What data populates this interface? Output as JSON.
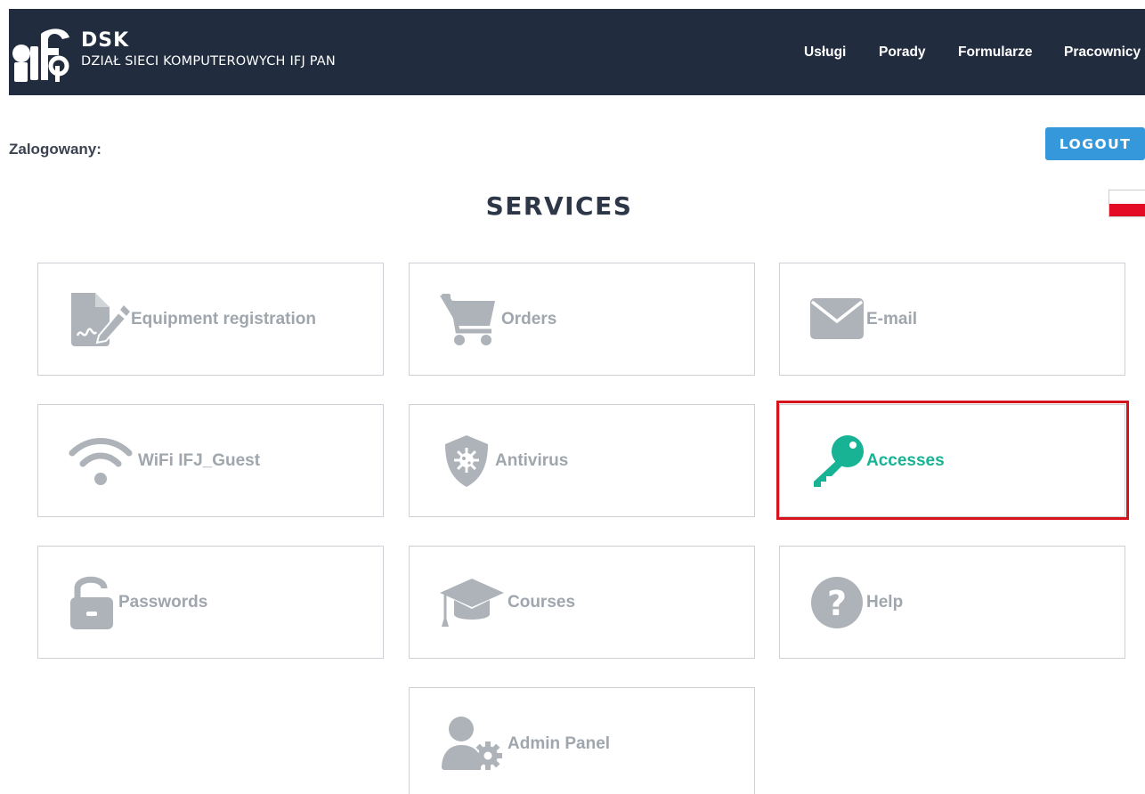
{
  "header": {
    "brand_title": "DSK",
    "brand_subtitle": "DZIAŁ SIECI KOMPUTEROWYCH IFJ PAN",
    "nav": [
      "Usługi",
      "Porady",
      "Formularze",
      "Pracownicy"
    ]
  },
  "session": {
    "logged_label": "Zalogowany:",
    "logout_label": "LOGOUT"
  },
  "page": {
    "title": "SERVICES",
    "language_flag": "pl-flag-icon"
  },
  "tiles": [
    {
      "label": "Equipment registration",
      "icon": "signature-document-icon"
    },
    {
      "label": "Orders",
      "icon": "shopping-cart-icon"
    },
    {
      "label": "E-mail",
      "icon": "envelope-icon"
    },
    {
      "label": "WiFi IFJ_Guest",
      "icon": "wifi-icon"
    },
    {
      "label": "Antivirus",
      "icon": "shield-virus-icon"
    },
    {
      "label": "Accesses",
      "icon": "key-icon",
      "active": true
    },
    {
      "label": "Passwords",
      "icon": "unlocked-padlock-icon"
    },
    {
      "label": "Courses",
      "icon": "graduation-cap-icon"
    },
    {
      "label": "Help",
      "icon": "question-circle-icon"
    },
    {
      "label": "Admin Panel",
      "icon": "user-gear-icon"
    }
  ],
  "colors": {
    "navbar": "#212c3e",
    "logout_button": "#3498db",
    "icon_inactive": "#aeb3b9",
    "icon_active": "#17b394",
    "highlight": "#d6131d"
  }
}
